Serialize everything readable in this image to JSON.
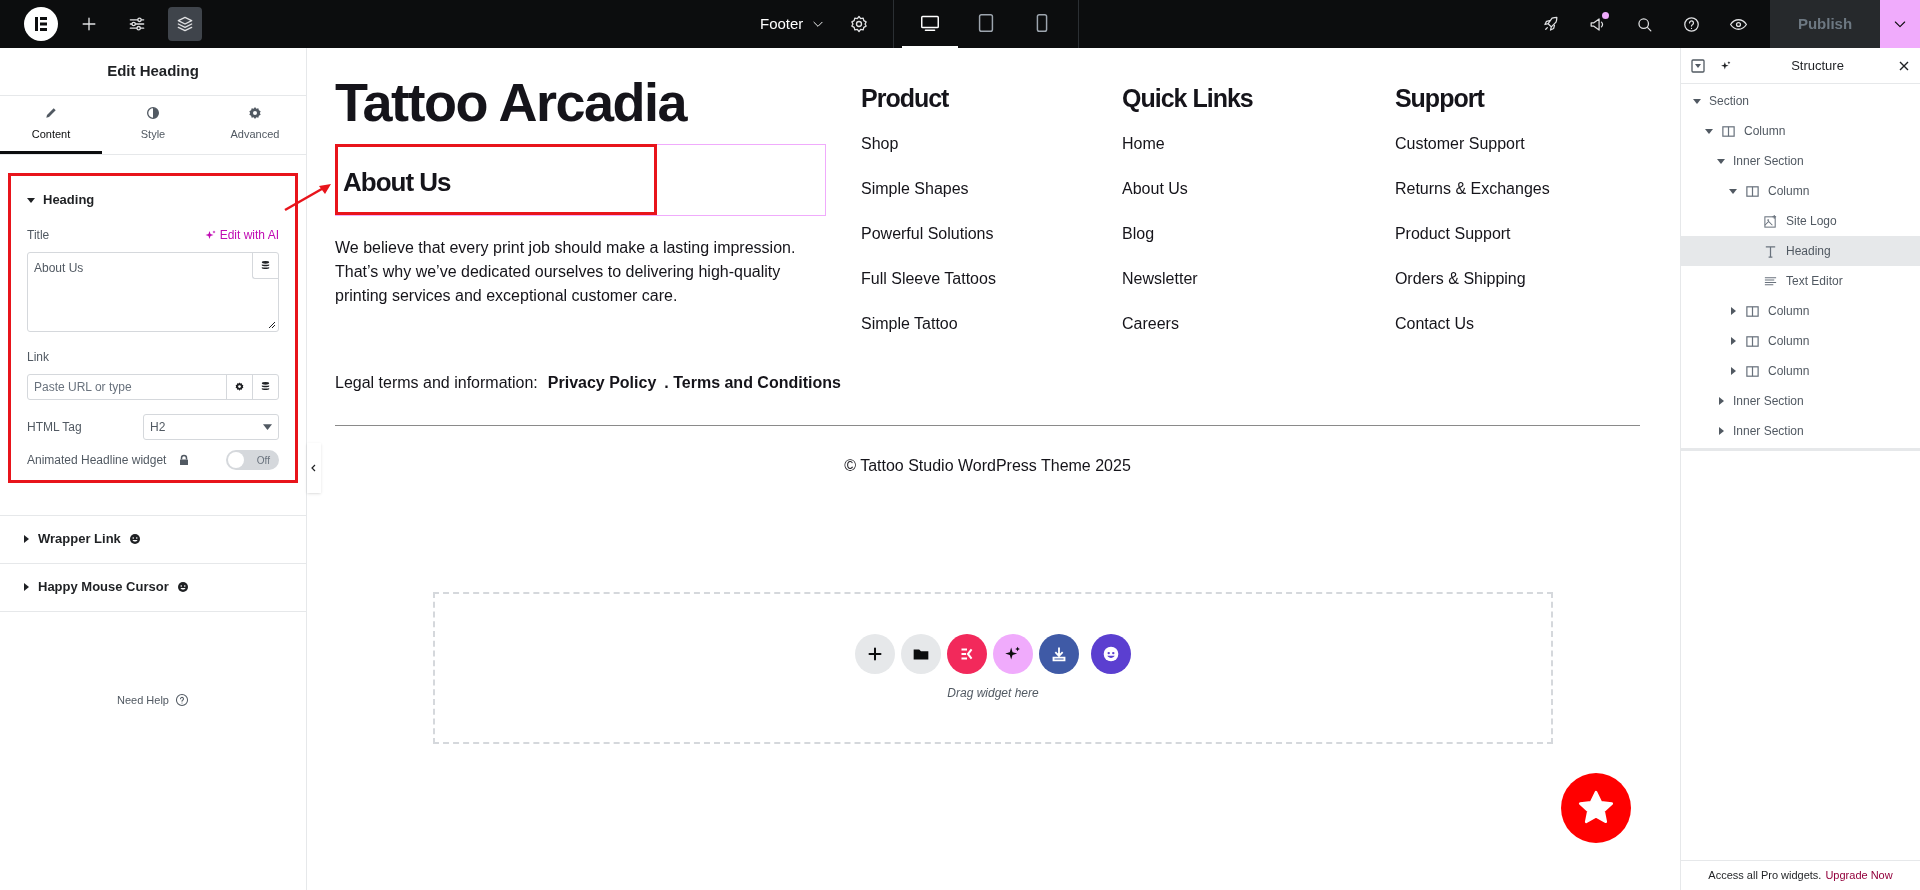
{
  "topbar": {
    "tools": [
      {
        "selected": false
      },
      {
        "selected": false
      },
      {
        "selected": true
      }
    ],
    "document_title": "Footer",
    "devices": [
      {
        "selected": true
      },
      {
        "selected": false
      },
      {
        "selected": false
      }
    ],
    "publish": "Publish"
  },
  "panel": {
    "title": "Edit Heading",
    "tabs": [
      {
        "label": "Content",
        "selected": true
      },
      {
        "label": "Style",
        "selected": false
      },
      {
        "label": "Advanced",
        "selected": false
      }
    ],
    "heading_section": {
      "title": "Heading",
      "expanded": true,
      "title_label": "Title",
      "edit_ai": "Edit with AI",
      "title_value": "About Us",
      "link_label": "Link",
      "link_placeholder": "Paste URL or type",
      "html_tag_label": "HTML Tag",
      "html_tag_value": "H2",
      "animated_label": "Animated Headline widget",
      "animated_toggle": {
        "on": false,
        "label": "Off"
      }
    },
    "other_sections": [
      {
        "title": "Wrapper Link",
        "expanded": false
      },
      {
        "title": "Happy Mouse Cursor",
        "expanded": false
      }
    ],
    "need_help": "Need Help"
  },
  "canvas": {
    "brand": "Tattoo Arcadia",
    "about_heading": "About Us",
    "about_text": "We believe that every print job should make a lasting impression. That’s why we’ve dedicated ourselves to delivering high-quality printing services and exceptional customer care.",
    "columns": [
      {
        "heading": "Product",
        "links": [
          "Shop",
          "Simple Shapes",
          "Powerful Solutions",
          "Full Sleeve Tattoos",
          "Simple Tattoo"
        ]
      },
      {
        "heading": "Quick Links",
        "links": [
          "Home",
          "About Us",
          "Blog",
          "Newsletter",
          "Careers"
        ]
      },
      {
        "heading": "Support",
        "links": [
          "Customer Support",
          "Returns & Exchanges",
          "Product Support",
          "Orders & Shipping",
          "Contact Us"
        ]
      }
    ],
    "legal_label": "Legal terms and information:",
    "legal_links": [
      "Privacy Policy",
      ". Terms and Conditions"
    ],
    "copyright": "© Tattoo Studio WordPress Theme 2025",
    "drop_zone": {
      "hint": "Drag widget here"
    }
  },
  "structure": {
    "title": "Structure",
    "tree": [
      {
        "label": "Section",
        "expanded": true,
        "selected": false,
        "children": [
          {
            "label": "Column",
            "kind": "column",
            "expanded": true,
            "selected": false,
            "children": [
              {
                "label": "Inner Section",
                "expanded": true,
                "selected": false,
                "children": [
                  {
                    "label": "Column",
                    "kind": "column",
                    "expanded": true,
                    "selected": false,
                    "children": [
                      {
                        "label": "Site Logo",
                        "kind": "image",
                        "selected": false
                      },
                      {
                        "label": "Heading",
                        "kind": "heading",
                        "selected": true
                      },
                      {
                        "label": "Text Editor",
                        "kind": "text",
                        "selected": false
                      }
                    ]
                  },
                  {
                    "label": "Column",
                    "kind": "column",
                    "expanded": false,
                    "selected": false
                  },
                  {
                    "label": "Column",
                    "kind": "column",
                    "expanded": false,
                    "selected": false
                  },
                  {
                    "label": "Column",
                    "kind": "column",
                    "expanded": false,
                    "selected": false
                  }
                ]
              },
              {
                "label": "Inner Section",
                "expanded": false,
                "selected": false
              },
              {
                "label": "Inner Section",
                "expanded": false,
                "selected": false
              }
            ]
          }
        ]
      }
    ],
    "promo_text": "Access all Pro widgets.",
    "promo_link": "Upgrade Now"
  }
}
